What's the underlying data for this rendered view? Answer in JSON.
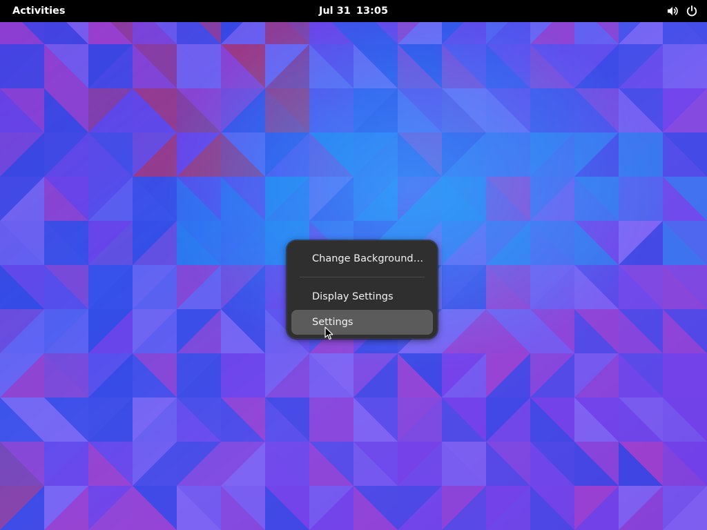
{
  "topbar": {
    "activities_label": "Activities",
    "clock": {
      "date": "Jul 31",
      "time": "13:05"
    },
    "status_icons": [
      "volume-icon",
      "power-icon"
    ]
  },
  "context_menu": {
    "items": [
      {
        "label": "Change Background…",
        "highlighted": false
      },
      {
        "label": "Display Settings",
        "highlighted": false
      },
      {
        "label": "Settings",
        "highlighted": true
      }
    ]
  },
  "colors": {
    "topbar_background": "#000000",
    "menu_background": "#2f2f2f",
    "menu_highlight": "#5b5b5b",
    "menu_text": "#ffffff",
    "wallpaper_palette": [
      "#2b44e0",
      "#7a3be8",
      "#b13bc4",
      "#1f8cf0",
      "#c42c54",
      "#8a6ff5"
    ]
  }
}
